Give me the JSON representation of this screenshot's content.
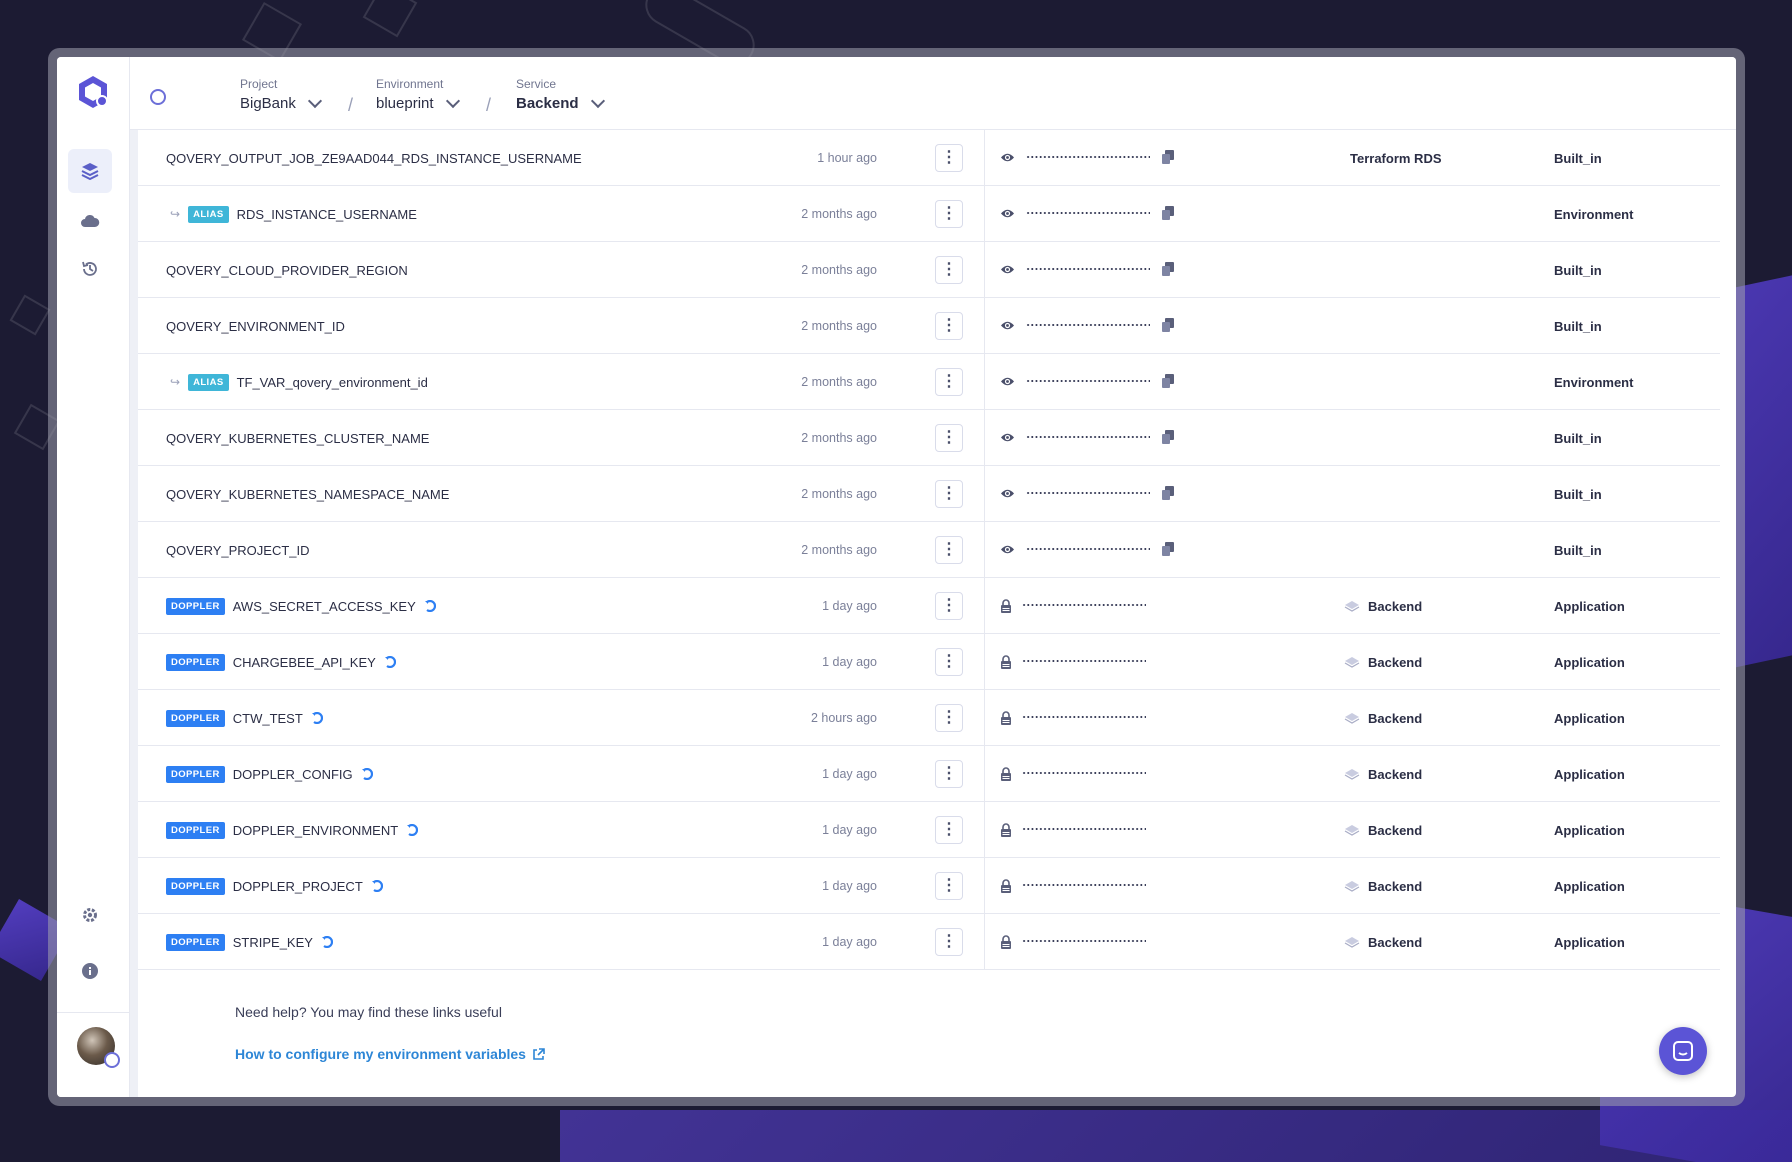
{
  "header": {
    "project": {
      "label": "Project",
      "value": "BigBank"
    },
    "environment": {
      "label": "Environment",
      "value": "blueprint"
    },
    "service": {
      "label": "Service",
      "value": "Backend"
    }
  },
  "sidebar": {
    "items": [
      {
        "icon": "layers-icon",
        "active": true
      },
      {
        "icon": "cloud-icon",
        "active": false
      },
      {
        "icon": "history-icon",
        "active": false
      }
    ],
    "bottom": [
      {
        "icon": "gear-icon"
      },
      {
        "icon": "info-icon"
      }
    ]
  },
  "variables": [
    {
      "name": "QOVERY_OUTPUT_JOB_ZE9AAD044_RDS_INSTANCE_USERNAME",
      "badge": "",
      "time": "1 hour ago",
      "secret": false,
      "service": "Terraform RDS",
      "scope": "Built_in"
    },
    {
      "name": "RDS_INSTANCE_USERNAME",
      "badge": "ALIAS",
      "time": "2 months ago",
      "secret": false,
      "service": "",
      "scope": "Environment"
    },
    {
      "name": "QOVERY_CLOUD_PROVIDER_REGION",
      "badge": "",
      "time": "2 months ago",
      "secret": false,
      "service": "",
      "scope": "Built_in"
    },
    {
      "name": "QOVERY_ENVIRONMENT_ID",
      "badge": "",
      "time": "2 months ago",
      "secret": false,
      "service": "",
      "scope": "Built_in"
    },
    {
      "name": "TF_VAR_qovery_environment_id",
      "badge": "ALIAS",
      "time": "2 months ago",
      "secret": false,
      "service": "",
      "scope": "Environment"
    },
    {
      "name": "QOVERY_KUBERNETES_CLUSTER_NAME",
      "badge": "",
      "time": "2 months ago",
      "secret": false,
      "service": "",
      "scope": "Built_in"
    },
    {
      "name": "QOVERY_KUBERNETES_NAMESPACE_NAME",
      "badge": "",
      "time": "2 months ago",
      "secret": false,
      "service": "",
      "scope": "Built_in"
    },
    {
      "name": "QOVERY_PROJECT_ID",
      "badge": "",
      "time": "2 months ago",
      "secret": false,
      "service": "",
      "scope": "Built_in"
    },
    {
      "name": "AWS_SECRET_ACCESS_KEY",
      "badge": "DOPPLER",
      "time": "1 day ago",
      "secret": true,
      "service": "Backend",
      "scope": "Application"
    },
    {
      "name": "CHARGEBEE_API_KEY",
      "badge": "DOPPLER",
      "time": "1 day ago",
      "secret": true,
      "service": "Backend",
      "scope": "Application"
    },
    {
      "name": "CTW_TEST",
      "badge": "DOPPLER",
      "time": "2 hours ago",
      "secret": true,
      "service": "Backend",
      "scope": "Application"
    },
    {
      "name": "DOPPLER_CONFIG",
      "badge": "DOPPLER",
      "time": "1 day ago",
      "secret": true,
      "service": "Backend",
      "scope": "Application"
    },
    {
      "name": "DOPPLER_ENVIRONMENT",
      "badge": "DOPPLER",
      "time": "1 day ago",
      "secret": true,
      "service": "Backend",
      "scope": "Application"
    },
    {
      "name": "DOPPLER_PROJECT",
      "badge": "DOPPLER",
      "time": "1 day ago",
      "secret": true,
      "service": "Backend",
      "scope": "Application"
    },
    {
      "name": "STRIPE_KEY",
      "badge": "DOPPLER",
      "time": "1 day ago",
      "secret": true,
      "service": "Backend",
      "scope": "Application"
    }
  ],
  "help": {
    "text": "Need help? You may find these links useful",
    "link": "How to configure my environment variables"
  },
  "colors": {
    "accent": "#5b54d6",
    "alias_badge": "#3fb6d8",
    "doppler_badge": "#2d7ff3",
    "link": "#2d86d6"
  }
}
